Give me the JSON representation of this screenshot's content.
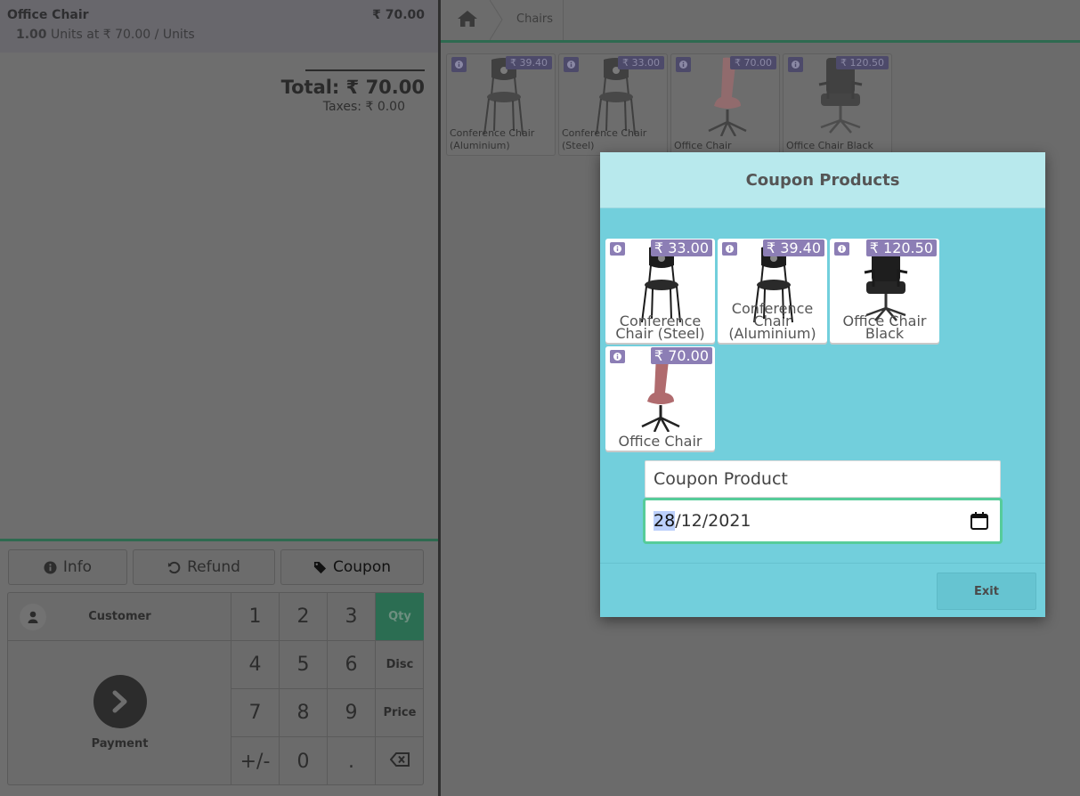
{
  "order": {
    "lines": [
      {
        "product": "Office Chair",
        "price": "₹ 70.00",
        "qty": "1.00",
        "unit_text": "Units at ₹ 70.00 / Units"
      }
    ],
    "total": "Total: ₹ 70.00",
    "taxes": "Taxes: ₹ 0.00"
  },
  "controls": {
    "info": {
      "label": "Info",
      "icon": "info-circle-icon"
    },
    "refund": {
      "label": "Refund",
      "icon": "undo-icon"
    },
    "coupon": {
      "label": "Coupon",
      "icon": "tag-icon"
    }
  },
  "numpad": {
    "customer_label": "Customer",
    "payment_label": "Payment",
    "keys": [
      "1",
      "2",
      "3",
      "4",
      "5",
      "6",
      "7",
      "8",
      "9",
      "+/-",
      "0",
      "."
    ],
    "modes": [
      "Qty",
      "Disc",
      "Price"
    ],
    "active_mode": "Qty",
    "backspace_icon": "backspace-icon"
  },
  "breadcrumb": {
    "home_icon": "home-icon",
    "category": "Chairs"
  },
  "products": [
    {
      "name": "Conference Chair (Aluminium)",
      "price": "₹ 39.40",
      "kind": "conference"
    },
    {
      "name": "Conference Chair (Steel)",
      "price": "₹ 33.00",
      "kind": "conference"
    },
    {
      "name": "Office Chair",
      "price": "₹ 70.00",
      "kind": "office-pink"
    },
    {
      "name": "Office Chair Black",
      "price": "₹ 120.50",
      "kind": "office-black"
    }
  ],
  "modal": {
    "title": "Coupon Products",
    "products": [
      {
        "name": "Conference Chair (Steel)",
        "price": "₹ 33.00",
        "kind": "conference"
      },
      {
        "name": "Conference Chair (Aluminium)",
        "price": "₹ 39.40",
        "kind": "conference"
      },
      {
        "name": "Office Chair Black",
        "price": "₹ 120.50",
        "kind": "office-black"
      },
      {
        "name": "Office Chair",
        "price": "₹ 70.00",
        "kind": "office-pink"
      }
    ],
    "coupon_input_value": "Coupon Product",
    "date": {
      "day": "28",
      "rest": "/12/2021"
    },
    "exit_label": "Exit"
  },
  "colors": {
    "accent_green": "#2b6d52",
    "modal_bg": "#72cfdc",
    "modal_header": "#b8e9ed",
    "price_badge": "#8c7eb5",
    "focus_border": "#56cc9a"
  }
}
